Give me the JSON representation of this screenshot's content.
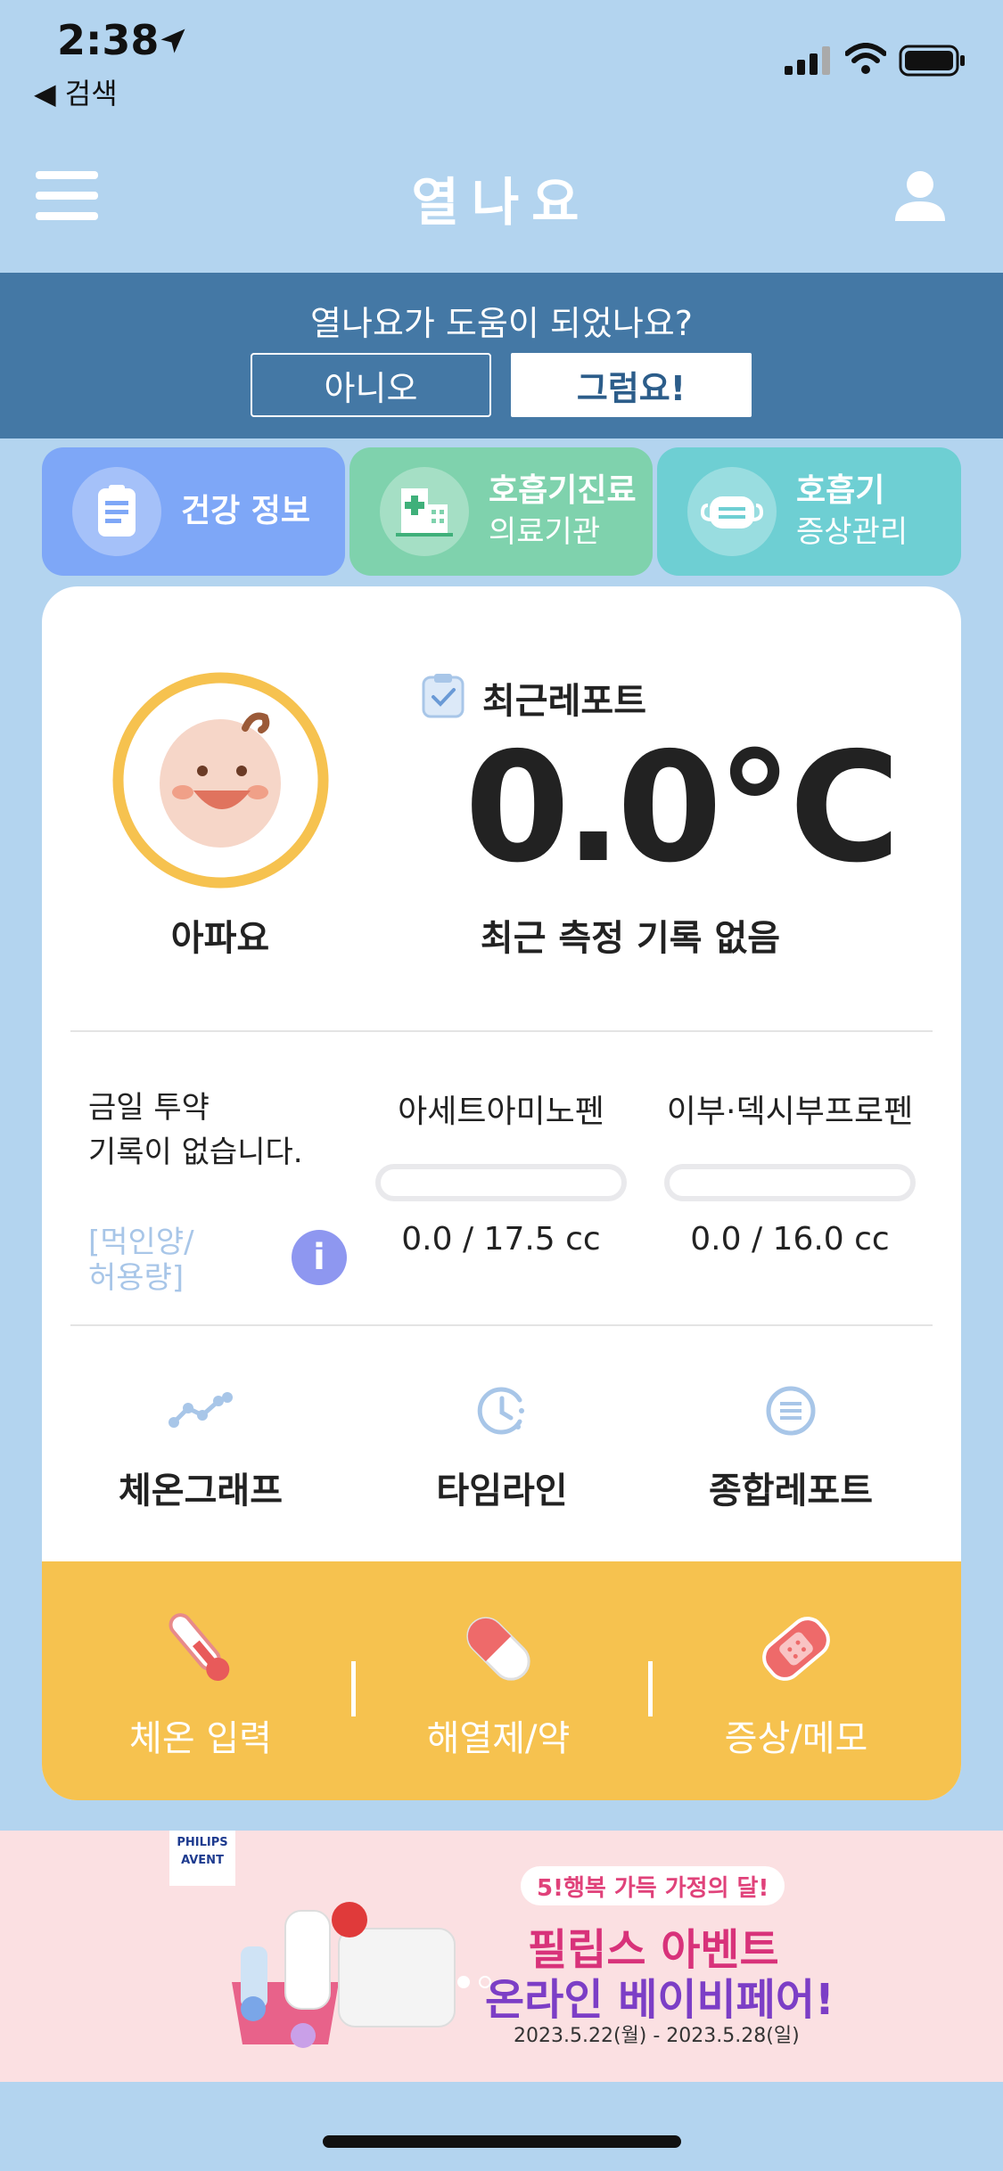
{
  "status_bar": {
    "time": "2:38",
    "back_label": "◀ 검색"
  },
  "header": {
    "title": "열나요"
  },
  "feedback": {
    "question": "열나요가 도움이 되었나요?",
    "no_label": "아니오",
    "yes_label": "그럼요!"
  },
  "tabs": [
    {
      "line1": "건강 정보",
      "line2": ""
    },
    {
      "line1": "호흡기진료",
      "line2": "의료기관"
    },
    {
      "line1": "호흡기",
      "line2": "증상관리"
    }
  ],
  "profile": {
    "status": "아파요"
  },
  "report": {
    "title": "최근레포트",
    "temperature": "0.0℃",
    "subtitle": "최근 측정 기록 없음"
  },
  "medication": {
    "no_record_line1": "금일 투약",
    "no_record_line2": "기록이 없습니다.",
    "link_line1": "[먹인양/",
    "link_line2": "허용량]",
    "info_glyph": "i",
    "drugs": [
      {
        "name": "아세트아미노펜",
        "value": "0.0 / 17.5 cc",
        "progress": 0
      },
      {
        "name": "이부·덱시부프로펜",
        "value": "0.0 / 16.0 cc",
        "progress": 0
      }
    ]
  },
  "quick_links": [
    {
      "label": "체온그래프",
      "icon": "line-graph-icon"
    },
    {
      "label": "타임라인",
      "icon": "clock-icon"
    },
    {
      "label": "종합레포트",
      "icon": "list-icon"
    }
  ],
  "actions": [
    {
      "label": "체온 입력",
      "icon": "thermometer-icon"
    },
    {
      "label": "해열제/약",
      "icon": "pill-icon"
    },
    {
      "label": "증상/메모",
      "icon": "bandage-icon"
    }
  ],
  "ad": {
    "brand_line1": "PHILIPS",
    "brand_line2": "AVENT",
    "tag": "5!행복 가득 가정의 달!",
    "headline1": "필립스 아벤트",
    "headline2": "온라인 베이비페어!",
    "dates": "2023.5.22(월) - 2023.5.28(일)"
  },
  "colors": {
    "background": "#b3d4ef",
    "feedback_bar": "#4478a5",
    "tab_health": "#7ea7f7",
    "tab_clinic": "#7fd2ad",
    "tab_symptom": "#6ecfd3",
    "action_bar": "#f6c24f",
    "avatar_ring": "#f6c24f"
  }
}
